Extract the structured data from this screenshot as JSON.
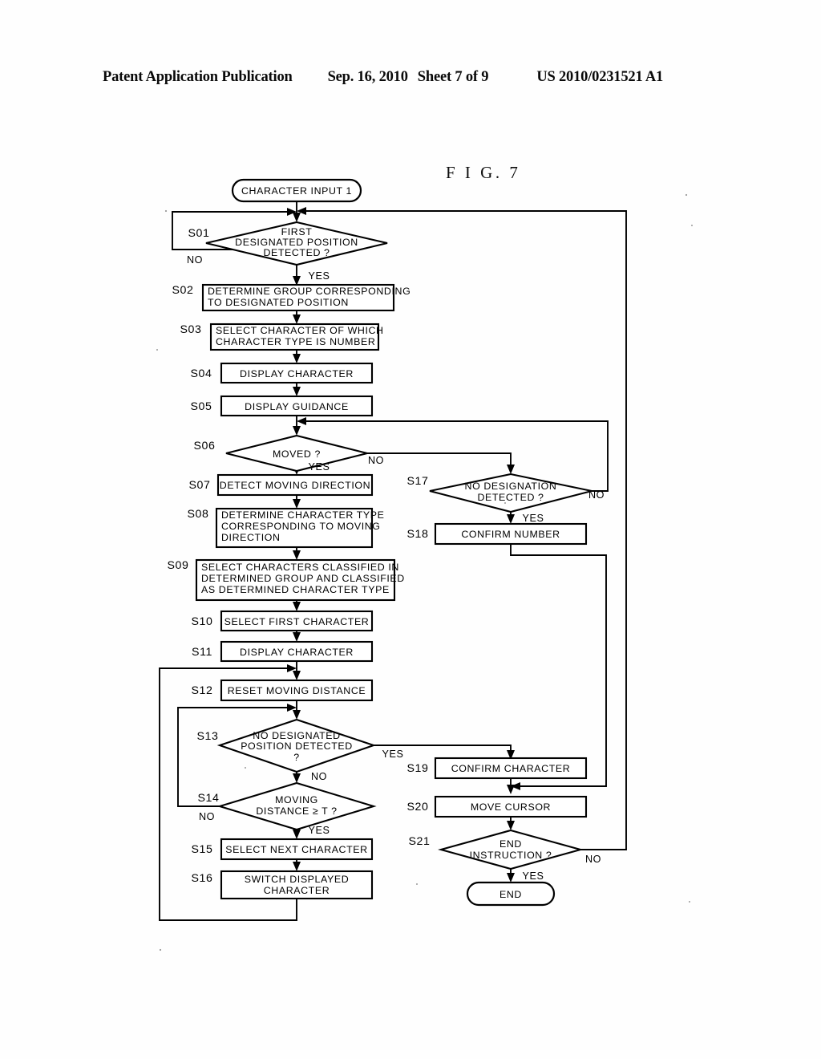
{
  "document": {
    "header": {
      "publication": "Patent Application Publication",
      "date": "Sep. 16, 2010",
      "sheet": "Sheet 7 of 9",
      "patent_number": "US 2010/0231521 A1"
    },
    "figure_label": "F I G.  7"
  },
  "flowchart": {
    "title": "CHARACTER INPUT 1",
    "terminals": [
      {
        "id": "start",
        "label": "CHARACTER INPUT 1"
      },
      {
        "id": "end",
        "label": "END"
      }
    ],
    "steps": [
      {
        "id": "S01",
        "step": "S01",
        "kind": "decision",
        "label": "FIRST\nDESIGNATED POSITION\nDETECTED ?",
        "branch_yes": "YES",
        "branch_no": "NO"
      },
      {
        "id": "S02",
        "step": "S02",
        "kind": "process",
        "label": "DETERMINE GROUP CORRESPONDING\nTO DESIGNATED POSITION"
      },
      {
        "id": "S03",
        "step": "S03",
        "kind": "process",
        "label": "SELECT CHARACTER OF WHICH\nCHARACTER TYPE IS NUMBER"
      },
      {
        "id": "S04",
        "step": "S04",
        "kind": "process",
        "label": "DISPLAY CHARACTER"
      },
      {
        "id": "S05",
        "step": "S05",
        "kind": "process",
        "label": "DISPLAY GUIDANCE"
      },
      {
        "id": "S06",
        "step": "S06",
        "kind": "decision",
        "label": "MOVED ?",
        "branch_yes": "YES",
        "branch_no": "NO"
      },
      {
        "id": "S07",
        "step": "S07",
        "kind": "process",
        "label": "DETECT MOVING DIRECTION"
      },
      {
        "id": "S08",
        "step": "S08",
        "kind": "process",
        "label": "DETERMINE CHARACTER TYPE\nCORRESPONDING TO MOVING\nDIRECTION"
      },
      {
        "id": "S09",
        "step": "S09",
        "kind": "process",
        "label": "SELECT CHARACTERS CLASSIFIED IN\nDETERMINED GROUP AND CLASSIFIED\nAS DETERMINED CHARACTER TYPE"
      },
      {
        "id": "S10",
        "step": "S10",
        "kind": "process",
        "label": "SELECT FIRST CHARACTER"
      },
      {
        "id": "S11",
        "step": "S11",
        "kind": "process",
        "label": "DISPLAY CHARACTER"
      },
      {
        "id": "S12",
        "step": "S12",
        "kind": "process",
        "label": "RESET MOVING DISTANCE"
      },
      {
        "id": "S13",
        "step": "S13",
        "kind": "decision",
        "label": "NO DESIGNATED\nPOSITION DETECTED\n?",
        "branch_yes": "YES",
        "branch_no": "NO"
      },
      {
        "id": "S14",
        "step": "S14",
        "kind": "decision",
        "label": "MOVING\nDISTANCE ≥ T ?",
        "branch_yes": "YES",
        "branch_no": "NO"
      },
      {
        "id": "S15",
        "step": "S15",
        "kind": "process",
        "label": "SELECT NEXT CHARACTER"
      },
      {
        "id": "S16",
        "step": "S16",
        "kind": "process",
        "label": "SWITCH DISPLAYED\nCHARACTER"
      },
      {
        "id": "S17",
        "step": "S17",
        "kind": "decision",
        "label": "NO DESIGNATION\nDETECTED ?",
        "branch_yes": "YES",
        "branch_no": "NO"
      },
      {
        "id": "S18",
        "step": "S18",
        "kind": "process",
        "label": "CONFIRM NUMBER"
      },
      {
        "id": "S19",
        "step": "S19",
        "kind": "process",
        "label": "CONFIRM CHARACTER"
      },
      {
        "id": "S20",
        "step": "S20",
        "kind": "process",
        "label": "MOVE CURSOR"
      },
      {
        "id": "S21",
        "step": "S21",
        "kind": "decision",
        "label": "END\nINSTRUCTION ?",
        "branch_yes": "YES",
        "branch_no": "NO"
      }
    ],
    "edges": [
      {
        "from": "start",
        "to": "S01",
        "label": ""
      },
      {
        "from": "S01",
        "to": "S02",
        "label": "YES"
      },
      {
        "from": "S01",
        "to": "S01",
        "label": "NO"
      },
      {
        "from": "S02",
        "to": "S03",
        "label": ""
      },
      {
        "from": "S03",
        "to": "S04",
        "label": ""
      },
      {
        "from": "S04",
        "to": "S05",
        "label": ""
      },
      {
        "from": "S05",
        "to": "S06",
        "label": ""
      },
      {
        "from": "S06",
        "to": "S07",
        "label": "YES"
      },
      {
        "from": "S06",
        "to": "S17",
        "label": "NO"
      },
      {
        "from": "S07",
        "to": "S08",
        "label": ""
      },
      {
        "from": "S08",
        "to": "S09",
        "label": ""
      },
      {
        "from": "S09",
        "to": "S10",
        "label": ""
      },
      {
        "from": "S10",
        "to": "S11",
        "label": ""
      },
      {
        "from": "S11",
        "to": "S12",
        "label": ""
      },
      {
        "from": "S12",
        "to": "S13",
        "label": ""
      },
      {
        "from": "S13",
        "to": "S19",
        "label": "YES"
      },
      {
        "from": "S13",
        "to": "S14",
        "label": "NO"
      },
      {
        "from": "S14",
        "to": "S15",
        "label": "YES"
      },
      {
        "from": "S14",
        "to": "S13",
        "label": "NO"
      },
      {
        "from": "S15",
        "to": "S16",
        "label": ""
      },
      {
        "from": "S16",
        "to": "S12",
        "label": ""
      },
      {
        "from": "S17",
        "to": "S18",
        "label": "YES"
      },
      {
        "from": "S17",
        "to": "S06",
        "label": "NO"
      },
      {
        "from": "S18",
        "to": "S20",
        "label": ""
      },
      {
        "from": "S19",
        "to": "S20",
        "label": ""
      },
      {
        "from": "S20",
        "to": "S21",
        "label": ""
      },
      {
        "from": "S21",
        "to": "end",
        "label": "YES"
      },
      {
        "from": "S21",
        "to": "S01",
        "label": "NO"
      }
    ],
    "colors": {
      "line": "#000000",
      "fill": "#ffffff",
      "text": "#000000"
    }
  }
}
